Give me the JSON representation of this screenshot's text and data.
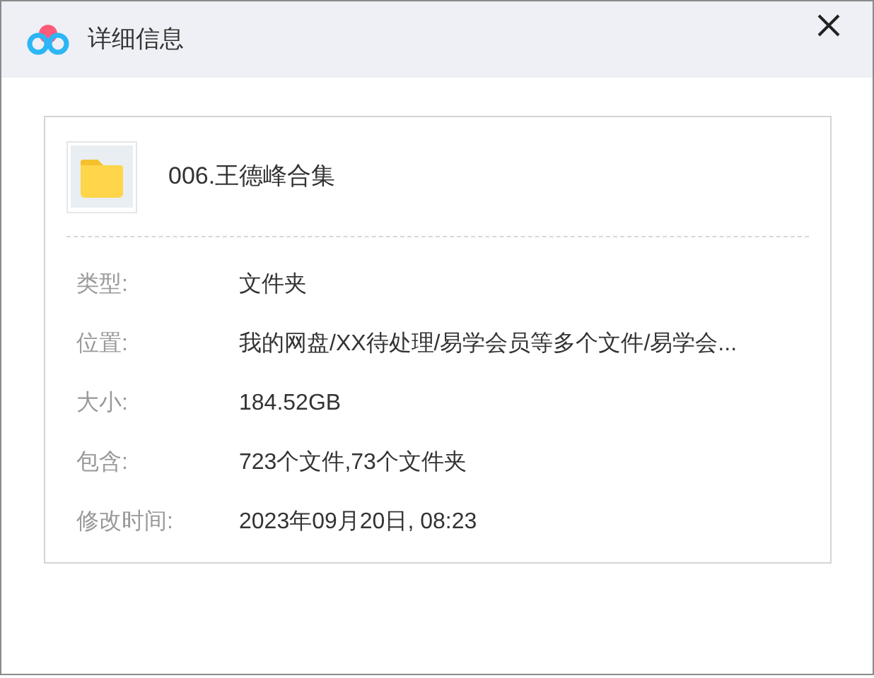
{
  "window": {
    "title": "详细信息"
  },
  "item": {
    "name": "006.王德峰合集"
  },
  "details": [
    {
      "label": "类型:",
      "value": "文件夹"
    },
    {
      "label": "位置:",
      "value": "我的网盘/XX待处理/易学会员等多个文件/易学会..."
    },
    {
      "label": "大小:",
      "value": "184.52GB"
    },
    {
      "label": "包含:",
      "value": "723个文件,73个文件夹"
    },
    {
      "label": "修改时间:",
      "value": "2023年09月20日, 08:23"
    }
  ]
}
